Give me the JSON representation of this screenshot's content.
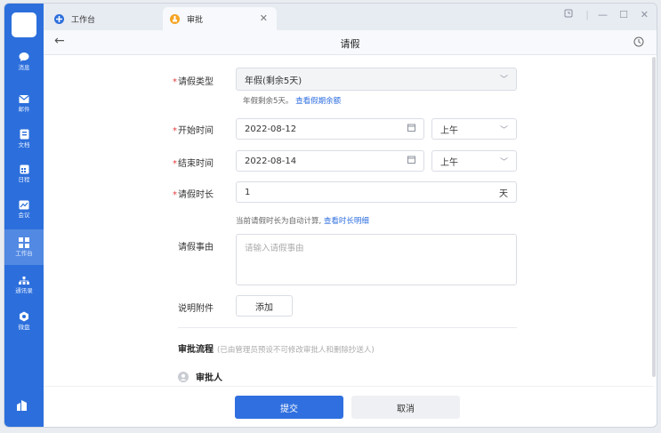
{
  "tabs": [
    {
      "label": "工作台",
      "icon": "workbench-tab-icon"
    },
    {
      "label": "审批",
      "icon": "approval-tab-icon"
    }
  ],
  "rail": {
    "items": [
      {
        "label": "消息",
        "icon": "message-icon"
      },
      {
        "label": "邮件",
        "icon": "mail-icon"
      },
      {
        "label": "文档",
        "icon": "doc-icon"
      },
      {
        "label": "日程",
        "icon": "calendar-icon"
      },
      {
        "label": "会议",
        "icon": "meeting-icon"
      },
      {
        "label": "工作台",
        "icon": "workbench-icon"
      },
      {
        "label": "通讯录",
        "icon": "contacts-icon"
      },
      {
        "label": "微盘",
        "icon": "drive-icon"
      }
    ],
    "active": "工作台"
  },
  "header": {
    "title": "请假"
  },
  "form": {
    "leave_type": {
      "label": "请假类型",
      "value": "年假(剩余5天)",
      "hint_text": "年假剩余5天。",
      "hint_link": "查看假期余额"
    },
    "start": {
      "label": "开始时间",
      "date": "2022-08-12",
      "period": "上午"
    },
    "end": {
      "label": "结束时间",
      "date": "2022-08-14",
      "period": "上午"
    },
    "duration": {
      "label": "请假时长",
      "value": "1",
      "unit": "天",
      "hint_text": "当前请假时长为自动计算,",
      "hint_link": "查看时长明细"
    },
    "reason": {
      "label": "请假事由",
      "placeholder": "请输入请假事由"
    },
    "attachment": {
      "label": "说明附件",
      "button": "添加"
    }
  },
  "flow": {
    "title": "审批流程",
    "note": "(已由管理员预设不可修改审批人和删除抄送人)",
    "approver_label": "审批人"
  },
  "footer": {
    "submit": "提交",
    "cancel": "取消"
  },
  "colors": {
    "rail": "#2c6fdc",
    "primary": "#2f6fe0",
    "required": "#e4393c"
  }
}
